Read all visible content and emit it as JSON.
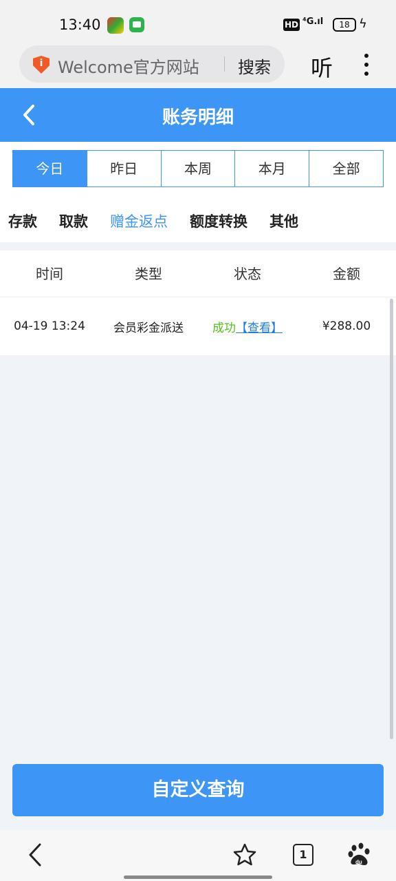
{
  "status_bar": {
    "time": "13:40",
    "hd": "HD",
    "network": "⁴G.ıl",
    "battery": "18"
  },
  "browser": {
    "url_text": "Welcome官方网站",
    "search_label": "搜索",
    "listen_label": "听",
    "tab_count": "1"
  },
  "header": {
    "title": "账务明细"
  },
  "period_tabs": [
    {
      "label": "今日",
      "active": true
    },
    {
      "label": "昨日",
      "active": false
    },
    {
      "label": "本周",
      "active": false
    },
    {
      "label": "本月",
      "active": false
    },
    {
      "label": "全部",
      "active": false
    }
  ],
  "type_tabs": [
    {
      "label": "存款",
      "active": false
    },
    {
      "label": "取款",
      "active": false
    },
    {
      "label": "赠金返点",
      "active": true
    },
    {
      "label": "额度转换",
      "active": false
    },
    {
      "label": "其他",
      "active": false
    }
  ],
  "table": {
    "columns": [
      "时间",
      "类型",
      "状态",
      "金额"
    ],
    "rows": [
      {
        "time": "04-19 13:24",
        "type": "会员彩金派送",
        "status": "成功",
        "link": "【查看】",
        "amount": "¥288.00"
      }
    ]
  },
  "query_button": "自定义查询",
  "colors": {
    "accent": "#3d95f5",
    "success": "#52c41a",
    "link": "#1e7fe0"
  }
}
